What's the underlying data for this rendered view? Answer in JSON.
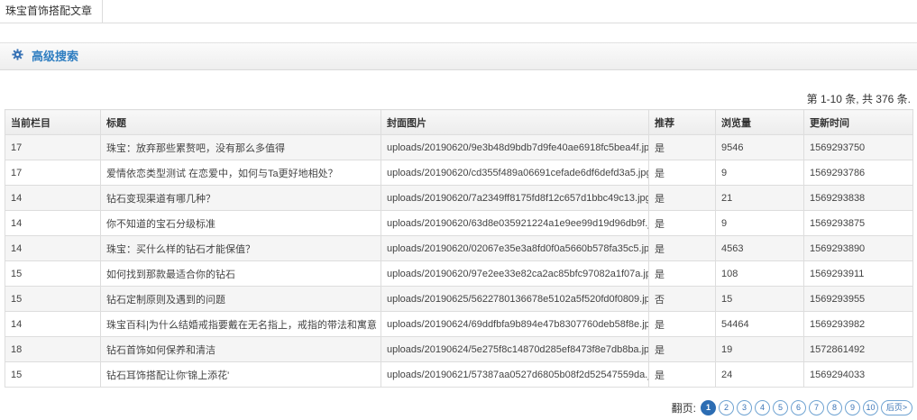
{
  "tab": {
    "label": "珠宝首饰搭配文章"
  },
  "search": {
    "title": "高级搜索",
    "icon": "gear-icon"
  },
  "summary": "第 1-10 条, 共 376 条.",
  "table": {
    "columns": [
      "当前栏目",
      "标题",
      "封面图片",
      "推荐",
      "浏览量",
      "更新时间"
    ],
    "rows": [
      [
        "17",
        "珠宝：放弃那些累赘吧，没有那么多值得",
        "uploads/20190620/9e3b48d9bdb7d9fe40ae6918fc5bea4f.jpg",
        "是",
        "9546",
        "1569293750"
      ],
      [
        "17",
        "爱情依恋类型测试 在恋爱中，如何与Ta更好地相处？",
        "uploads/20190620/cd355f489a06691cefade6df6defd3a5.jpg",
        "是",
        "9",
        "1569293786"
      ],
      [
        "14",
        "钻石变现渠道有哪几种？",
        "uploads/20190620/7a2349ff8175fd8f12c657d1bbc49c13.jpg",
        "是",
        "21",
        "1569293838"
      ],
      [
        "14",
        "你不知道的宝石分级标准",
        "uploads/20190620/63d8e035921224a1e9ee99d19d96db9f.jpg",
        "是",
        "9",
        "1569293875"
      ],
      [
        "14",
        "珠宝：买什么样的钻石才能保值？",
        "uploads/20190620/02067e35e3a8fd0f0a5660b578fa35c5.jpg",
        "是",
        "4563",
        "1569293890"
      ],
      [
        "15",
        "如何找到那款最适合你的钻石",
        "uploads/20190620/97e2ee33e82ca2ac85bfc97082a1f07a.jpg",
        "是",
        "108",
        "1569293911"
      ],
      [
        "15",
        "钻石定制原则及遇到的问题",
        "uploads/20190625/5622780136678e5102a5f520fd0f0809.jpg",
        "否",
        "15",
        "1569293955"
      ],
      [
        "14",
        "珠宝百科|为什么结婚戒指要戴在无名指上，戒指的带法和寓意",
        "uploads/20190624/69ddfbfa9b894e47b8307760deb58f8e.jpg",
        "是",
        "54464",
        "1569293982"
      ],
      [
        "18",
        "钻石首饰如何保养和清洁",
        "uploads/20190624/5e275f8c14870d285ef8473f8e7db8ba.jpg",
        "是",
        "19",
        "1572861492"
      ],
      [
        "15",
        "钻石耳饰搭配让你'锦上添花'",
        "uploads/20190621/57387aa0527d6805b08f2d52547559da.jpg",
        "是",
        "24",
        "1569294033"
      ]
    ]
  },
  "pager": {
    "label": "翻页:",
    "pages": [
      "1",
      "2",
      "3",
      "4",
      "5",
      "6",
      "7",
      "8",
      "9",
      "10"
    ],
    "current": "1",
    "last_label": "后页>"
  }
}
